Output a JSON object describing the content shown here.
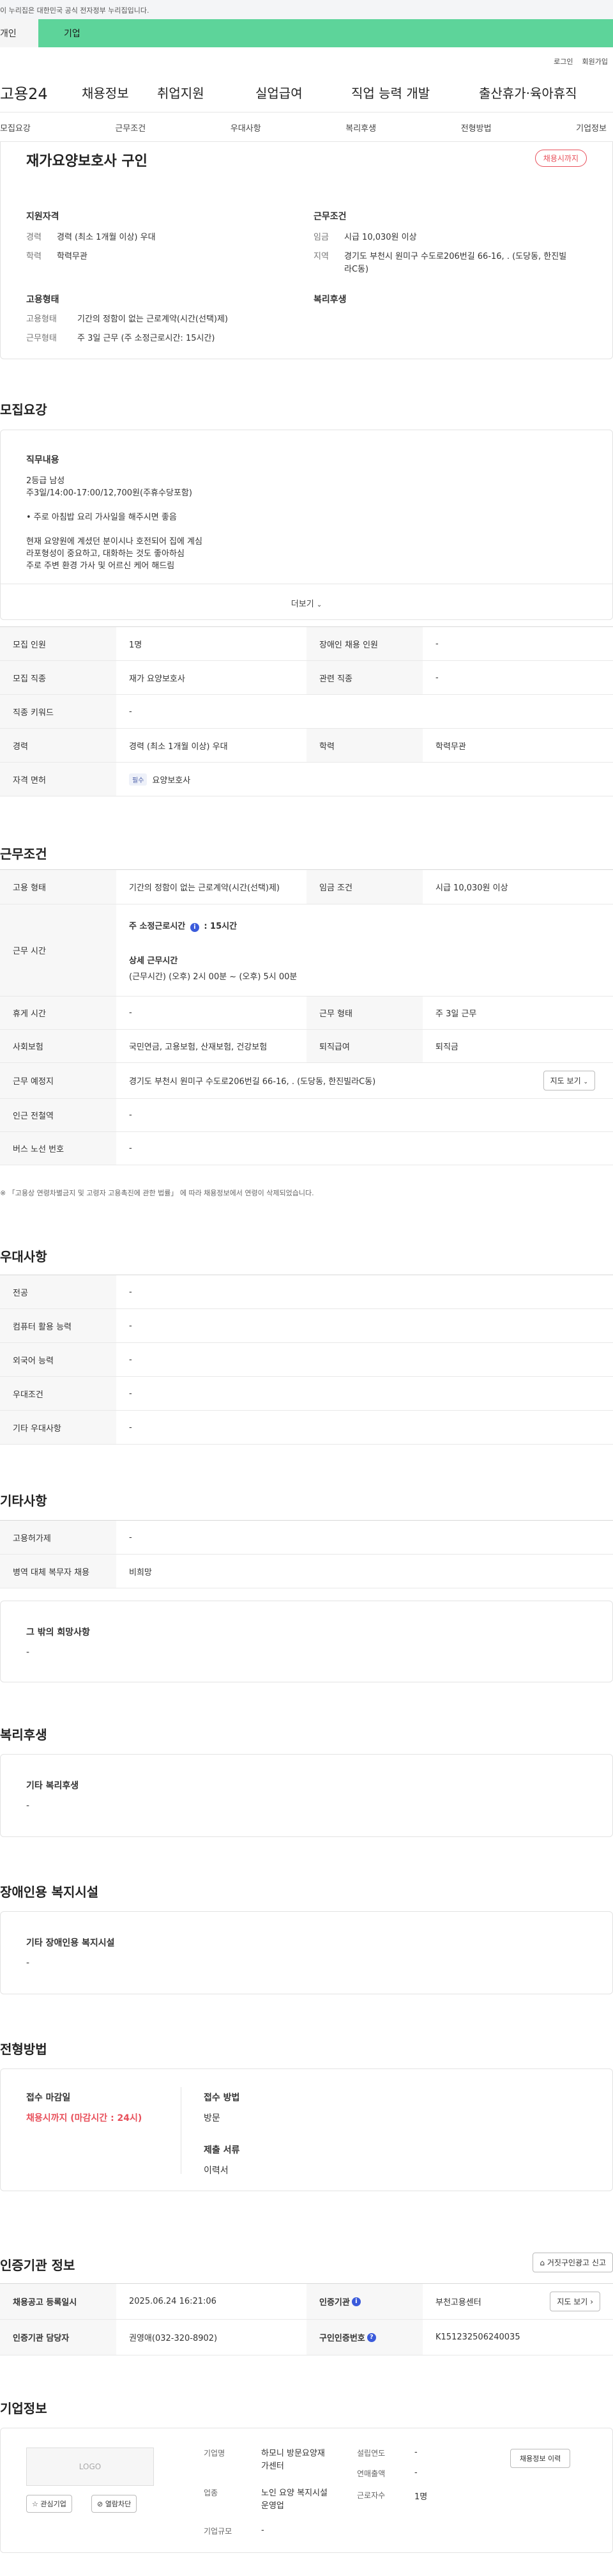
{
  "gov_banner": "이 누리집은 대한민국 공식 전자정부 누리집입니다.",
  "top_tabs": {
    "person": "개인",
    "corp": "기업"
  },
  "util_links": [
    "로그인",
    "회원가입"
  ],
  "gnb": {
    "logo": "고용24",
    "menu": [
      "채용정보",
      "취업지원",
      "실업급여",
      "직업 능력 개발",
      "출산휴가·육아휴직"
    ]
  },
  "subnav": [
    "모집요강",
    "근무조건",
    "우대사항",
    "복리후생",
    "전형방법",
    "기업정보"
  ],
  "summary": {
    "title": "재가요양보호사 구인",
    "deadline_badge": "채용시까지",
    "qual_heading": "지원자격",
    "qual": [
      {
        "k": "경력",
        "v": "경력 (최소 1개월 이상) 우대"
      },
      {
        "k": "학력",
        "v": "학력무관"
      }
    ],
    "work_heading": "근무조건",
    "work": [
      {
        "k": "임금",
        "v": "시급 10,030원 이상"
      },
      {
        "k": "지역",
        "v": "경기도 부천시 원미구 수도로206번길 66-16, . (도당동, 한진빌라C동)"
      }
    ],
    "emp_heading": "고용형태",
    "emp": [
      {
        "k": "고용형태",
        "v": "기간의 정함이 없는 근로계약(시간(선택)제)"
      },
      {
        "k": "근무형태",
        "v": "주 3일 근무 (주 소정근로시간: 15시간)"
      }
    ],
    "welfare_heading": "복리후생"
  },
  "recruit": {
    "title": "모집요강",
    "duty_heading": "직무내용",
    "duty_lines": [
      "2등급 남성",
      "주3일/14:00-17:00/12,700원(주휴수당포함)",
      "",
      "• 주로 아침밥 요리 가사일을 해주시면 좋음",
      "",
      "현재 요양원에 계셨던 분이시나 호전되어 집에 계심",
      "라포형성이 중요하고, 대화하는 것도 좋아하심",
      "주로 주변 환경 가사 및 어르신 케어 해드림"
    ],
    "more": "더보기",
    "rows": [
      {
        "th1": "모집 인원",
        "td1": "1명",
        "th2": "장애인 채용 인원",
        "td2": "-"
      },
      {
        "th1": "모집 직종",
        "td1": "재가 요양보호사",
        "th2": "관련 직종",
        "td2": "-"
      },
      {
        "th1": "직종 키워드",
        "td1": "-"
      },
      {
        "th1": "경력",
        "td1": "경력 (최소 1개월 이상) 우대",
        "th2": "학력",
        "td2": "학력무관"
      },
      {
        "th1": "자격 면허",
        "chip": "필수",
        "td1": "요양보호사"
      }
    ]
  },
  "work": {
    "title": "근무조건",
    "emp_th": "고용 형태",
    "emp_td": "기간의 정함이 없는 근로계약(시간(선택)제)",
    "wage_th": "임금 조건",
    "wage_td": "시급 10,030원 이상",
    "time_th": "근무 시간",
    "weekly_label": "주 소정근로시간",
    "weekly_value": ": 15시간",
    "detail_label": "상세 근무시간",
    "detail_value": "(근무시간) (오후) 2시 00분 ~ (오후) 5시 00분",
    "break_th": "휴게 시간",
    "break_td": "-",
    "shape_th": "근무 형태",
    "shape_td": "주 3일 근무",
    "ins_th": "사회보험",
    "ins_td": "국민연금, 고용보험, 산재보험, 건강보험",
    "retire_th": "퇴직급여",
    "retire_td": "퇴직금",
    "place_th": "근무 예정지",
    "place_td": "경기도 부천시 원미구 수도로206번길 66-16, . (도당동, 한진빌라C동)",
    "map_btn": "지도 보기",
    "subway_th": "인근 전철역",
    "subway_td": "-",
    "bus_th": "버스 노선 번호",
    "bus_td": "-",
    "note": "※ 「고용상 연령차별금지 및 고령자 고용촉진에 관한 법률」 에 따라 채용정보에서 연령이 삭제되었습니다."
  },
  "pref": {
    "title": "우대사항",
    "rows": [
      {
        "th": "전공",
        "td": "-"
      },
      {
        "th": "컴퓨터 활용 능력",
        "td": "-"
      },
      {
        "th": "외국어 능력",
        "td": "-"
      },
      {
        "th": "우대조건",
        "td": "-"
      },
      {
        "th": "기타 우대사항",
        "td": "-"
      }
    ]
  },
  "etc": {
    "title": "기타사항",
    "rows": [
      {
        "th": "고용허가제",
        "td": "-"
      },
      {
        "th": "병역 대체 복무자 채용",
        "td": "비희망"
      }
    ],
    "box_title": "그 밖의 희망사항",
    "box_value": "-"
  },
  "welfare": {
    "title": "복리후생",
    "box_title": "기타 복리후생",
    "box_value": "-"
  },
  "disabled": {
    "title": "장애인용 복지시설",
    "box_title": "기타 장애인용 복지시설",
    "box_value": "-"
  },
  "selection": {
    "title": "전형방법",
    "deadline_label": "접수 마감일",
    "deadline_value": "채용시까지 (마감시간 : 24시)",
    "method_label": "접수 방법",
    "method_value": "방문",
    "docs_label": "제출 서류",
    "docs_value": "이력서"
  },
  "auth": {
    "title": "인증기관 정보",
    "report_btn": "거짓구인광고 신고",
    "reg_th": "채용공고 등록일시",
    "reg_td": "2025.06.24 16:21:06",
    "org_th": "인증기관",
    "org_td": "부천고용센터",
    "map_btn": "지도 보기",
    "mgr_th": "인증기관 담당자",
    "mgr_td": "권영애(032-320-8902)",
    "no_th": "구인인증번호",
    "no_td": "K151232506240035"
  },
  "company": {
    "title": "기업정보",
    "logo_text": "LOGO",
    "fav_btn": "관심기업",
    "block_btn": "열람차단",
    "name_label": "기업명",
    "name_value": "하모니 방문요양재가센터",
    "biz_label": "업종",
    "biz_value": "노인 요양 복지시설 운영업",
    "size_label": "기업규모",
    "size_value": "-",
    "year_label": "설립연도",
    "year_value": "-",
    "sales_label": "연매출액",
    "sales_value": "-",
    "emp_label": "근로자수",
    "emp_value": "1명",
    "hire_btn": "채용정보 이력"
  }
}
